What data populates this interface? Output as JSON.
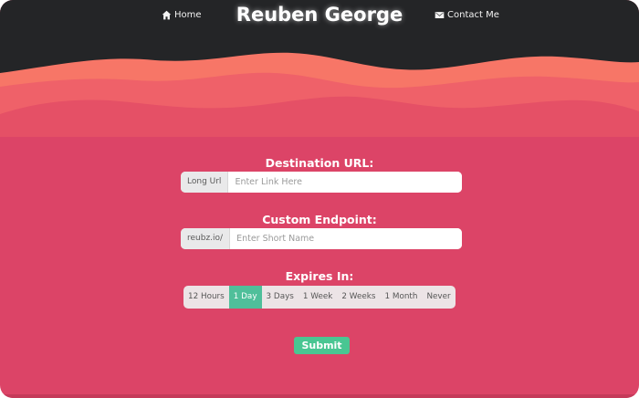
{
  "header": {
    "title": "Reuben George",
    "home_label": "Home",
    "contact_label": "Contact Me",
    "home_icon": "home-icon",
    "contact_icon": "envelope-icon"
  },
  "form": {
    "destination": {
      "label": "Destination URL:",
      "addon": "Long Url",
      "placeholder": "Enter Link Here",
      "value": ""
    },
    "endpoint": {
      "label": "Custom Endpoint:",
      "addon": "reubz.io/",
      "placeholder": "Enter Short Name",
      "value": ""
    },
    "expires": {
      "label": "Expires In:",
      "options": [
        "12 Hours",
        "1 Day",
        "3 Days",
        "1 Week",
        "2 Weeks",
        "1 Month",
        "Never"
      ],
      "selected": "1 Day"
    },
    "submit_label": "Submit"
  },
  "colors": {
    "header_bg": "#242527",
    "wave_1": "#f77667",
    "wave_2": "#ef6169",
    "wave_3": "#e55066",
    "page_bg": "#dc4467",
    "accent": "#49c692",
    "selected_option": "#4fbf9a"
  }
}
